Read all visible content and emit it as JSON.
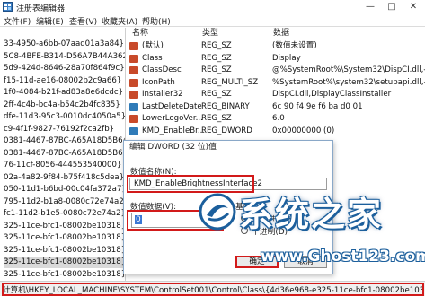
{
  "window": {
    "title": "注册表编辑器",
    "min": "—",
    "max": "□",
    "close": "✕"
  },
  "menu": [
    "文件(F)",
    "编辑(E)",
    "查看(V)",
    "收藏夹(A)",
    "帮助(H)"
  ],
  "tree": {
    "items": [
      "33-4950-a6bb-07aad01a3a84}",
      "5C8-4BFE-B314-D56A7B44A362}",
      "5d9-424d-8646-28a70f864f9c}",
      "f15-11d-ae16-08002b2c9a66}",
      "1f0-4084-b21f-ad83a8e6dcdc}",
      "2ff-4c4b-bc4a-b54c2b4fc835}",
      "dfe-11d3-95c3-0010dc4050a5}",
      "c9-4f1f-9827-76192f2ca2fb}",
      "0381-4467-87BC-A65A18D5B648}",
      "0381-4467-87BC-A65A18D5B648}",
      "76-11cf-8056-444553540000}",
      "02a-4a82-9f84-b75f418c5dea}",
      "050-11d1-b6bd-00c04fa372a7}",
      "795-11d2-b1a8-0080c72e74a2}",
      "fc1-11d2-b1e5-0080c72e74a2}",
      "325-11ce-bfc1-08002be10318}",
      "325-11ce-bfc1-08002be10318}",
      "325-11ce-bfc1-08002be10318}",
      "325-11ce-bfc1-08002be10318}",
      "325-11ce-bfc1-08002be10318}",
      "325-11ce-bfc1-08002be10318}"
    ]
  },
  "values": {
    "headers": {
      "name": "名称",
      "type": "类型",
      "data": "数据"
    },
    "rows": [
      {
        "icon": "ab-icon",
        "name": "(默认)",
        "type": "REG_SZ",
        "data": "(数值未设置)"
      },
      {
        "icon": "ab-icon",
        "name": "Class",
        "type": "REG_SZ",
        "data": "Display"
      },
      {
        "icon": "ab-icon",
        "name": "ClassDesc",
        "type": "REG_SZ",
        "data": "@%SystemRoot%\\System32\\DispCI.dll,-3100"
      },
      {
        "icon": "ab-icon",
        "name": "IconPath",
        "type": "REG_MULTI_SZ",
        "data": "%SystemRoot%\\system32\\setupapi.dll,-1"
      },
      {
        "icon": "ab-icon",
        "name": "Installer32",
        "type": "REG_SZ",
        "data": "DispCI.dll,DisplayClassInstaller"
      },
      {
        "icon": "bin-icon",
        "name": "LastDeleteDate",
        "type": "REG_BINARY",
        "data": "6c 90 f4 9e f6 ba d0 01"
      },
      {
        "icon": "ab-icon",
        "name": "LowerLogoVer...",
        "type": "REG_SZ",
        "data": "6.0"
      },
      {
        "icon": "bin-icon",
        "name": "KMD_EnableBr...",
        "type": "REG_DWORD",
        "data": "0x00000000 (0)"
      }
    ]
  },
  "dialog": {
    "title": "编辑 DWORD (32 位)值",
    "name_label": "数值名称(N):",
    "name_value": "KMD_EnableBrightnessInterface2",
    "data_label": "数值数据(V):",
    "data_value": "0",
    "base_label": "基数",
    "radix_hex": "十六进制(H)",
    "radix_dec": "十进制(D)",
    "ok": "确定",
    "cancel": "取消"
  },
  "status": {
    "path": "计算机\\HKEY_LOCAL_MACHINE\\SYSTEM\\ControlSet001\\Control\\Class\\{4d36e968-e325-11ce-bfc1-08002be10318}"
  },
  "watermark": {
    "brand": "系统之家",
    "url": "www.Ghost123.com"
  },
  "colors": {
    "highlight_red": "#d21a1a",
    "watermark_blue": "#1c5f9c"
  }
}
